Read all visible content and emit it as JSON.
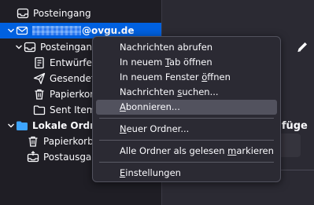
{
  "folder_tree": {
    "rows": [
      {
        "label": "Posteingang",
        "icon": "inbox-icon"
      },
      {
        "email_domain": "@ovgu.de",
        "icon": "mail-account-icon",
        "twisty": "chevron-down-icon"
      },
      {
        "label": "Posteingang",
        "icon": "inbox-icon",
        "twisty": "chevron-down-icon"
      },
      {
        "label": "Entwürfe",
        "icon": "drafts-icon"
      },
      {
        "label": "Gesendet",
        "icon": "sent-icon"
      },
      {
        "label": "Papierkorb",
        "icon": "trash-icon"
      },
      {
        "label": "Sent Items",
        "icon": "folder-icon"
      },
      {
        "label": "Lokale Ordner",
        "icon": "folder-icon",
        "twisty": "chevron-down-icon"
      },
      {
        "label": "Papierkorb",
        "icon": "trash-icon"
      },
      {
        "label": "Postausgang",
        "icon": "outbox-icon"
      }
    ]
  },
  "main": {
    "partial_heading": "zufüge"
  },
  "context_menu": {
    "items": [
      {
        "pre": "Nachrichten abrufen",
        "u": "",
        "post": ""
      },
      {
        "pre": "In neuem ",
        "u": "T",
        "post": "ab öffnen"
      },
      {
        "pre": "In neuem Fenster ",
        "u": "ö",
        "post": "ffnen"
      },
      {
        "pre": "Nachrichten ",
        "u": "s",
        "post": "uchen..."
      },
      {
        "pre": "",
        "u": "A",
        "post": "bonnieren..."
      },
      {
        "pre": "",
        "u": "N",
        "post": "euer Ordner..."
      },
      {
        "pre": "Alle Ordner als gelesen ",
        "u": "m",
        "post": "arkieren"
      },
      {
        "pre": "",
        "u": "E",
        "post": "instellungen"
      }
    ]
  },
  "colors": {
    "selected_row": "#0061e0",
    "menu_hover": "#52525e",
    "folder_accent": "#3da5ff"
  }
}
